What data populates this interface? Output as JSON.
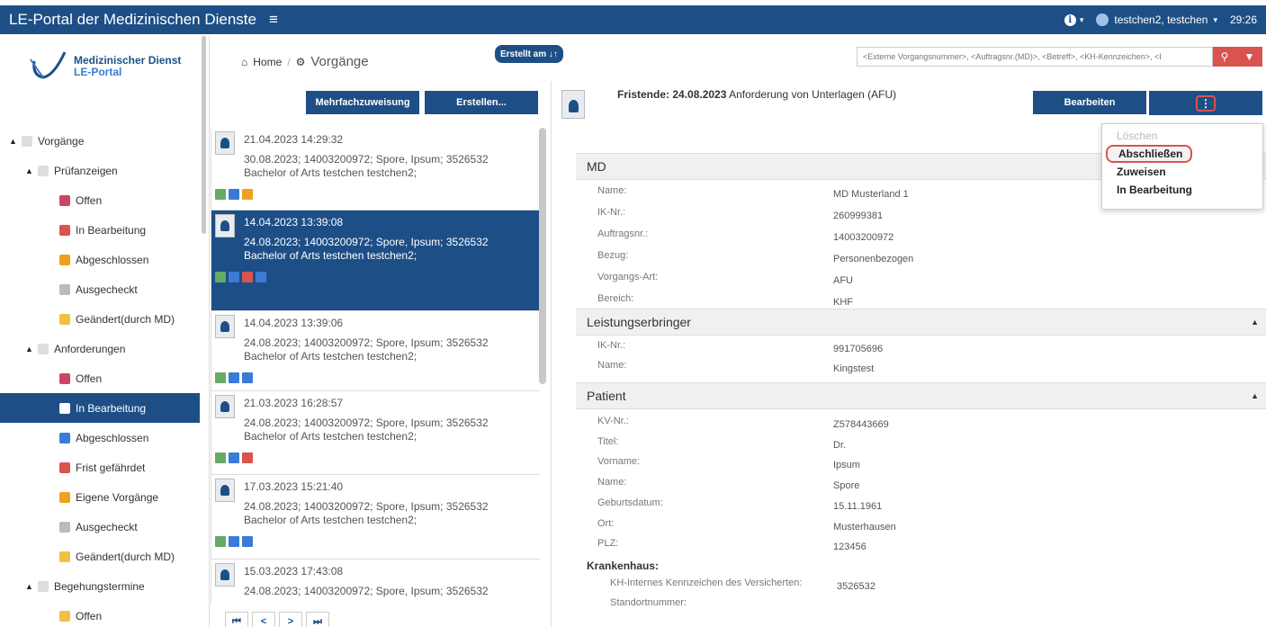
{
  "app": {
    "title": "LE-Portal der Medizinischen Dienste",
    "user": "testchen2, testchen",
    "timer": "29:26"
  },
  "logo": {
    "line1": "Medizinischer Dienst",
    "line2": "LE-Portal"
  },
  "sidebar": {
    "items": [
      {
        "label": "Vorgänge",
        "level": 0
      },
      {
        "label": "Prüfanzeigen",
        "level": 1
      },
      {
        "label": "Offen",
        "level": 2
      },
      {
        "label": "In Bearbeitung",
        "level": 2
      },
      {
        "label": "Abgeschlossen",
        "level": 2
      },
      {
        "label": "Ausgecheckt",
        "level": 2
      },
      {
        "label": "Geändert(durch MD)",
        "level": 2
      },
      {
        "label": "Anforderungen",
        "level": 1
      },
      {
        "label": "Offen",
        "level": 2
      },
      {
        "label": "In Bearbeitung",
        "level": 2
      },
      {
        "label": "Abgeschlossen",
        "level": 2
      },
      {
        "label": "Frist gefährdet",
        "level": 2
      },
      {
        "label": "Eigene Vorgänge",
        "level": 2
      },
      {
        "label": "Ausgecheckt",
        "level": 2
      },
      {
        "label": "Geändert(durch MD)",
        "level": 2
      },
      {
        "label": "Begehungstermine",
        "level": 1
      },
      {
        "label": "Offen",
        "level": 2
      }
    ]
  },
  "breadcrumb": {
    "home": "Home",
    "current": "Vorgänge"
  },
  "toolbar": {
    "sort_label": "Erstellt am ↓↑",
    "multi_assign": "Mehrfachzuweisung",
    "create": "Erstellen..."
  },
  "list": {
    "items": [
      {
        "date": "21.04.2023 14:29:32",
        "line1": "30.08.2023; 14003200972; Spore, Ipsum; 3526532",
        "line2": "Bachelor of Arts testchen testchen2;"
      },
      {
        "date": "14.04.2023 13:39:08",
        "line1": "24.08.2023; 14003200972; Spore, Ipsum; 3526532",
        "line2": "Bachelor of Arts testchen testchen2;"
      },
      {
        "date": "14.04.2023 13:39:06",
        "line1": "24.08.2023; 14003200972; Spore, Ipsum; 3526532",
        "line2": "Bachelor of Arts testchen testchen2;"
      },
      {
        "date": "21.03.2023 16:28:57",
        "line1": "24.08.2023; 14003200972; Spore, Ipsum; 3526532",
        "line2": "Bachelor of Arts testchen testchen2;"
      },
      {
        "date": "17.03.2023 15:21:40",
        "line1": "24.08.2023; 14003200972; Spore, Ipsum; 3526532",
        "line2": "Bachelor of Arts testchen testchen2;"
      },
      {
        "date": "15.03.2023 17:43:08",
        "line1": "24.08.2023; 14003200972; Spore, Ipsum; 3526532",
        "line2": ""
      }
    ]
  },
  "pager": [
    "⏮",
    "<",
    ">",
    "⏭"
  ],
  "search": {
    "placeholder": "<Externe Vorgangsnummer>, <Auftragsnr.(MD)>, <Betreff>, <KH-Kennzeichen>, <I"
  },
  "detail": {
    "fristende_label": "Fristende: 24.08.2023",
    "fristende_text": "Anforderung von Unterlagen (AFU)",
    "edit": "Bearbeiten",
    "kebab": "⋮",
    "menu": [
      "Löschen",
      "Abschließen",
      "Zuweisen",
      "In Bearbeitung"
    ],
    "md": {
      "title": "MD",
      "fields": [
        {
          "label": "Name:",
          "value": "MD Musterland 1"
        },
        {
          "label": "IK-Nr.:",
          "value": "260999381"
        },
        {
          "label": "Auftragsnr.:",
          "value": "14003200972"
        },
        {
          "label": "Bezug:",
          "value": "Personenbezogen"
        },
        {
          "label": "Vorgangs-Art:",
          "value": "AFU"
        },
        {
          "label": "Bereich:",
          "value": "KHF"
        }
      ]
    },
    "le": {
      "title": "Leistungserbringer",
      "fields": [
        {
          "label": "IK-Nr.:",
          "value": "991705696"
        },
        {
          "label": "Name:",
          "value": "Kingstest"
        }
      ]
    },
    "patient": {
      "title": "Patient",
      "fields": [
        {
          "label": "KV-Nr.:",
          "value": "Z578443669"
        },
        {
          "label": "Titel:",
          "value": "Dr."
        },
        {
          "label": "Vorname:",
          "value": "Ipsum"
        },
        {
          "label": "Name:",
          "value": "Spore"
        },
        {
          "label": "Geburtsdatum:",
          "value": "15.11.1961"
        },
        {
          "label": "Ort:",
          "value": "Musterhausen"
        },
        {
          "label": "PLZ:",
          "value": "123456"
        }
      ]
    },
    "krankenhaus": {
      "title": "Krankenhaus:",
      "fields": [
        {
          "label": "KH-Internes Kennzeichen des Versicherten:",
          "value": "3526532"
        },
        {
          "label": "Standortnummer:",
          "value": ""
        }
      ]
    }
  }
}
